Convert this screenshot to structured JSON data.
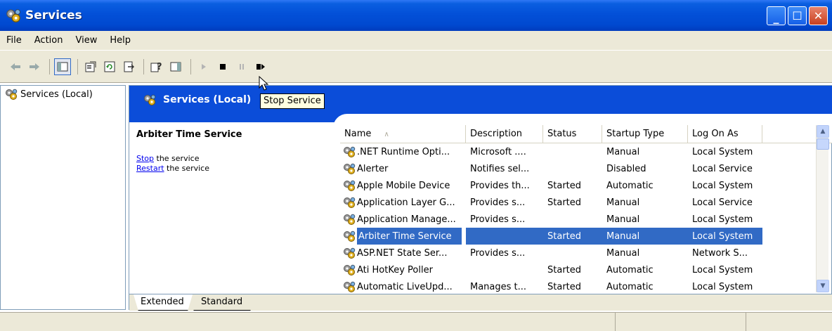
{
  "window": {
    "title": "Services"
  },
  "menu": [
    "File",
    "Action",
    "View",
    "Help"
  ],
  "toolbar": {
    "tooltip": "Stop Service"
  },
  "tree": {
    "root_label": "Services (Local)"
  },
  "panel_header": {
    "title": "Services (Local)"
  },
  "description": {
    "service_name": "Arbiter Time Service",
    "stop_link": "Stop",
    "stop_rest": " the service",
    "restart_link": "Restart",
    "restart_rest": " the service"
  },
  "list": {
    "columns": [
      "Name",
      "Description",
      "Status",
      "Startup Type",
      "Log On As"
    ],
    "sort_arrow": "∧",
    "rows": [
      {
        "name": ".NET Runtime Opti...",
        "description": "Microsoft ....",
        "status": "",
        "startup": "Manual",
        "logon": "Local System"
      },
      {
        "name": "Alerter",
        "description": "Notifies sel...",
        "status": "",
        "startup": "Disabled",
        "logon": "Local Service"
      },
      {
        "name": "Apple Mobile Device",
        "description": "Provides th...",
        "status": "Started",
        "startup": "Automatic",
        "logon": "Local System"
      },
      {
        "name": "Application Layer G...",
        "description": "Provides s...",
        "status": "Started",
        "startup": "Manual",
        "logon": "Local Service"
      },
      {
        "name": "Application Manage...",
        "description": "Provides s...",
        "status": "",
        "startup": "Manual",
        "logon": "Local System"
      },
      {
        "name": "Arbiter Time Service",
        "description": "",
        "status": "Started",
        "startup": "Manual",
        "logon": "Local System"
      },
      {
        "name": "ASP.NET State Ser...",
        "description": "Provides s...",
        "status": "",
        "startup": "Manual",
        "logon": "Network S..."
      },
      {
        "name": "Ati HotKey Poller",
        "description": "",
        "status": "Started",
        "startup": "Automatic",
        "logon": "Local System"
      },
      {
        "name": "Automatic LiveUpd...",
        "description": "Manages t...",
        "status": "Started",
        "startup": "Automatic",
        "logon": "Local System"
      }
    ]
  },
  "tabs": [
    "Extended",
    "Standard"
  ],
  "colors": {
    "titlebar": "#0350d8",
    "selection": "#316ac5",
    "panel_header": "#0b4dd9"
  },
  "icons": {
    "service": "gears-icon",
    "back": "back-arrow-icon",
    "forward": "forward-arrow-icon",
    "stop": "stop-icon",
    "pause": "pause-icon",
    "play": "play-icon",
    "restart": "restart-icon"
  }
}
